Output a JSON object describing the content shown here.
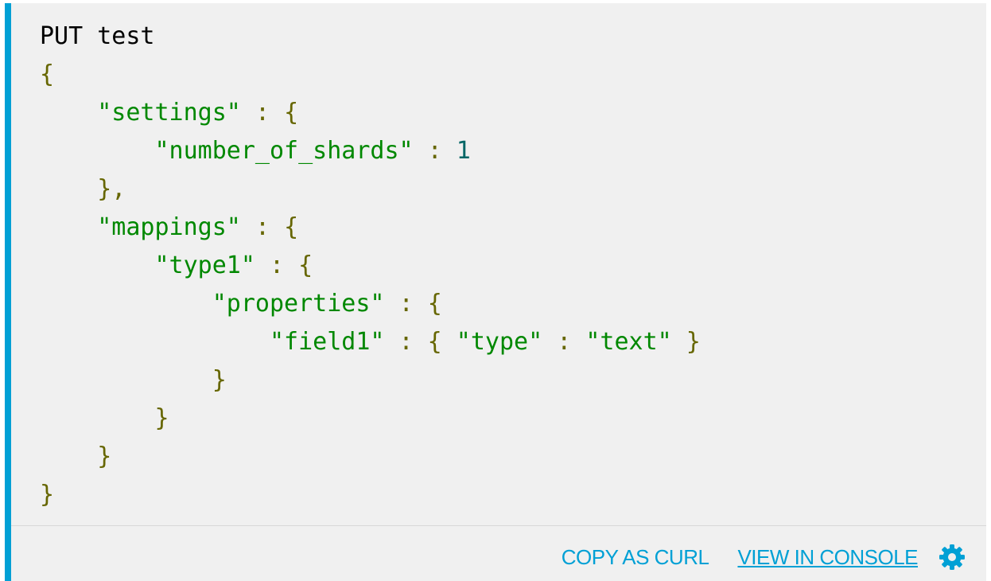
{
  "code": {
    "request_method": "PUT",
    "request_path": "test",
    "lines": [
      [
        {
          "t": "method",
          "v": "PUT"
        },
        {
          "t": "plain",
          "v": " "
        },
        {
          "t": "path",
          "v": "test"
        }
      ],
      [
        {
          "t": "punc",
          "v": "{"
        }
      ],
      [
        {
          "t": "plain",
          "v": "    "
        },
        {
          "t": "str",
          "v": "\"settings\""
        },
        {
          "t": "plain",
          "v": " "
        },
        {
          "t": "punc",
          "v": ":"
        },
        {
          "t": "plain",
          "v": " "
        },
        {
          "t": "punc",
          "v": "{"
        }
      ],
      [
        {
          "t": "plain",
          "v": "        "
        },
        {
          "t": "str",
          "v": "\"number_of_shards\""
        },
        {
          "t": "plain",
          "v": " "
        },
        {
          "t": "punc",
          "v": ":"
        },
        {
          "t": "plain",
          "v": " "
        },
        {
          "t": "num",
          "v": "1"
        }
      ],
      [
        {
          "t": "plain",
          "v": "    "
        },
        {
          "t": "punc",
          "v": "},"
        }
      ],
      [
        {
          "t": "plain",
          "v": "    "
        },
        {
          "t": "str",
          "v": "\"mappings\""
        },
        {
          "t": "plain",
          "v": " "
        },
        {
          "t": "punc",
          "v": ":"
        },
        {
          "t": "plain",
          "v": " "
        },
        {
          "t": "punc",
          "v": "{"
        }
      ],
      [
        {
          "t": "plain",
          "v": "        "
        },
        {
          "t": "str",
          "v": "\"type1\""
        },
        {
          "t": "plain",
          "v": " "
        },
        {
          "t": "punc",
          "v": ":"
        },
        {
          "t": "plain",
          "v": " "
        },
        {
          "t": "punc",
          "v": "{"
        }
      ],
      [
        {
          "t": "plain",
          "v": "            "
        },
        {
          "t": "str",
          "v": "\"properties\""
        },
        {
          "t": "plain",
          "v": " "
        },
        {
          "t": "punc",
          "v": ":"
        },
        {
          "t": "plain",
          "v": " "
        },
        {
          "t": "punc",
          "v": "{"
        }
      ],
      [
        {
          "t": "plain",
          "v": "                "
        },
        {
          "t": "str",
          "v": "\"field1\""
        },
        {
          "t": "plain",
          "v": " "
        },
        {
          "t": "punc",
          "v": ":"
        },
        {
          "t": "plain",
          "v": " "
        },
        {
          "t": "punc",
          "v": "{"
        },
        {
          "t": "plain",
          "v": " "
        },
        {
          "t": "str",
          "v": "\"type\""
        },
        {
          "t": "plain",
          "v": " "
        },
        {
          "t": "punc",
          "v": ":"
        },
        {
          "t": "plain",
          "v": " "
        },
        {
          "t": "str",
          "v": "\"text\""
        },
        {
          "t": "plain",
          "v": " "
        },
        {
          "t": "punc",
          "v": "}"
        }
      ],
      [
        {
          "t": "plain",
          "v": "            "
        },
        {
          "t": "punc",
          "v": "}"
        }
      ],
      [
        {
          "t": "plain",
          "v": "        "
        },
        {
          "t": "punc",
          "v": "}"
        }
      ],
      [
        {
          "t": "plain",
          "v": "    "
        },
        {
          "t": "punc",
          "v": "}"
        }
      ],
      [
        {
          "t": "punc",
          "v": "}"
        }
      ]
    ]
  },
  "actions": {
    "copy_as_curl": "COPY AS CURL",
    "view_in_console": "VIEW IN CONSOLE",
    "settings_icon": "gear-icon"
  },
  "colors": {
    "accent": "#00a0d5",
    "background": "#f0f0f0",
    "string": "#008800",
    "punctuation": "#666600",
    "number": "#006666",
    "plain": "#000000"
  }
}
